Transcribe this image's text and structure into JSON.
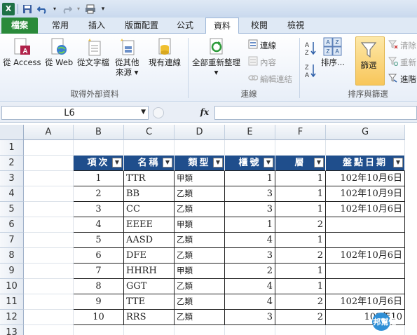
{
  "quick_access": {
    "excel_icon": "excel-logo",
    "save_icon": "save-icon",
    "undo_icon": "undo-icon",
    "redo_icon": "redo-icon",
    "print_icon": "quick-print-icon",
    "customize_icon": "customize-qat-icon"
  },
  "tabs": [
    {
      "label": "檔案"
    },
    {
      "label": "常用"
    },
    {
      "label": "插入"
    },
    {
      "label": "版面配置"
    },
    {
      "label": "公式"
    },
    {
      "label": "資料"
    },
    {
      "label": "校閱"
    },
    {
      "label": "檢視"
    }
  ],
  "ribbon": {
    "get_external": {
      "from_access": "從 Access",
      "from_web": "從 Web",
      "from_text": "從文字檔",
      "from_other_1": "從其他",
      "from_other_2": "來源",
      "existing": "現有連線",
      "group_label": "取得外部資料"
    },
    "connections": {
      "refresh_all_1": "全部重新整理",
      "connections": "連線",
      "properties": "內容",
      "edit_links": "編輯連結",
      "group_label": "連線"
    },
    "sort_filter": {
      "sort": "排序...",
      "filter": "篩選",
      "clear": "清除",
      "reapply": "重新",
      "advanced": "進階",
      "group_label": "排序與篩選",
      "sort_az": "A Z",
      "sort_za": "Z A"
    }
  },
  "formula_bar": {
    "name_box": "L6",
    "fx": "fx",
    "formula": ""
  },
  "columns": [
    "A",
    "B",
    "C",
    "D",
    "E",
    "F",
    "G"
  ],
  "rows": [
    "1",
    "2",
    "3",
    "4",
    "5",
    "6",
    "7",
    "8",
    "9",
    "10",
    "11",
    "12",
    "13"
  ],
  "table": {
    "headers": [
      "項次",
      "名稱",
      "類型",
      "櫃號",
      "層",
      "盤點日期"
    ],
    "rows": [
      [
        "1",
        "TTR",
        "甲類",
        "1",
        "1",
        "102年10月6日"
      ],
      [
        "2",
        "BB",
        "乙類",
        "3",
        "1",
        "102年10月9日"
      ],
      [
        "3",
        "CC",
        "乙類",
        "3",
        "1",
        "102年10月6日"
      ],
      [
        "4",
        "EEEE",
        "甲類",
        "1",
        "2",
        ""
      ],
      [
        "5",
        "AASD",
        "乙類",
        "4",
        "1",
        ""
      ],
      [
        "6",
        "DFE",
        "乙類",
        "3",
        "2",
        "102年10月6日"
      ],
      [
        "7",
        "HHRH",
        "甲類",
        "2",
        "1",
        ""
      ],
      [
        "8",
        "GGT",
        "乙類",
        "4",
        "1",
        ""
      ],
      [
        "9",
        "TTE",
        "乙類",
        "4",
        "2",
        "102年10月6日"
      ],
      [
        "10",
        "RRS",
        "乙類",
        "3",
        "2",
        "102年10"
      ]
    ]
  },
  "colors": {
    "header_fill": "#1f4e8c",
    "file_tab": "#2a8a3a",
    "filter_active": "#f8c65a"
  },
  "watermark": {
    "text": "iT邦幫忙"
  }
}
